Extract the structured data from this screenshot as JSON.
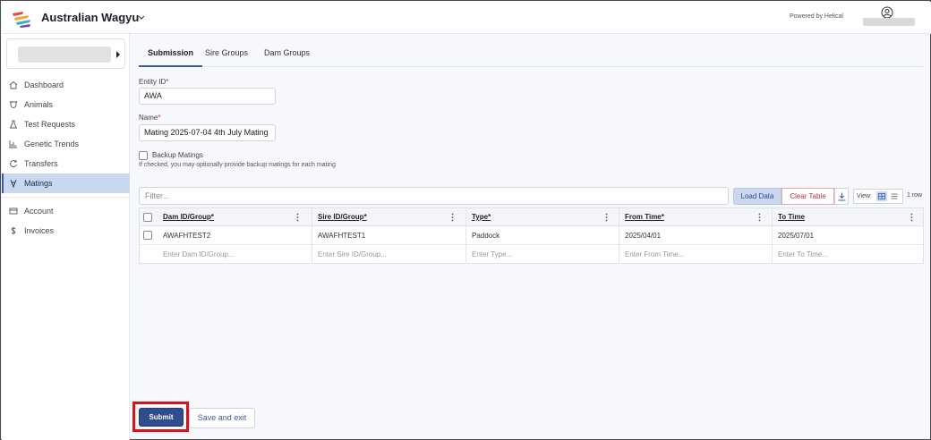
{
  "header": {
    "app_title": "Australian Wagyu",
    "powered_by": "Powered by Helical"
  },
  "sidebar": {
    "items": [
      {
        "label": "Dashboard",
        "icon": "home-icon"
      },
      {
        "label": "Animals",
        "icon": "cow-icon"
      },
      {
        "label": "Test Requests",
        "icon": "flask-icon"
      },
      {
        "label": "Genetic Trends",
        "icon": "bar-chart-icon"
      },
      {
        "label": "Transfers",
        "icon": "transfer-icon"
      },
      {
        "label": "Matings",
        "icon": "mating-icon",
        "active": true
      }
    ],
    "secondary_items": [
      {
        "label": "Account",
        "icon": "account-card-icon"
      },
      {
        "label": "Invoices",
        "icon": "dollar-icon"
      }
    ]
  },
  "tabs": [
    {
      "label": "Submission",
      "active": true
    },
    {
      "label": "Sire Groups"
    },
    {
      "label": "Dam Groups"
    }
  ],
  "form": {
    "entity_id_label": "Entity ID",
    "entity_id_value": "AWA",
    "name_label": "Name",
    "name_value": "Mating 2025-07-04 4th July Mating",
    "required_mark": "*",
    "backup_label": "Backup Matings",
    "backup_hint": "If checked, you may optionally provide backup matings for each mating"
  },
  "toolbar": {
    "filter_placeholder": "Filter...",
    "load_data": "Load Data",
    "clear_table": "Clear Table",
    "view_label": "View:",
    "row_count": "1 row"
  },
  "table": {
    "columns": [
      "Dam ID/Group*",
      "Sire ID/Group*",
      "Type*",
      "From Time*",
      "To Time"
    ],
    "rows": [
      [
        "AWAFHTEST2",
        "AWAFHTEST1",
        "Paddock",
        "2025/04/01",
        "2025/07/01"
      ]
    ],
    "placeholders": [
      "Enter Dam ID/Group...",
      "Enter Sire ID/Group...",
      "Enter Type...",
      "Enter From Time...",
      "Enter To Time..."
    ]
  },
  "footer": {
    "submit": "Submit",
    "save_exit": "Save and exit"
  },
  "colors": {
    "accent": "#3a58a8",
    "active_nav": "#c9d7ef",
    "submit": "#2f4c8f",
    "highlight": "#d4141c",
    "clear_table": "#b03040"
  }
}
